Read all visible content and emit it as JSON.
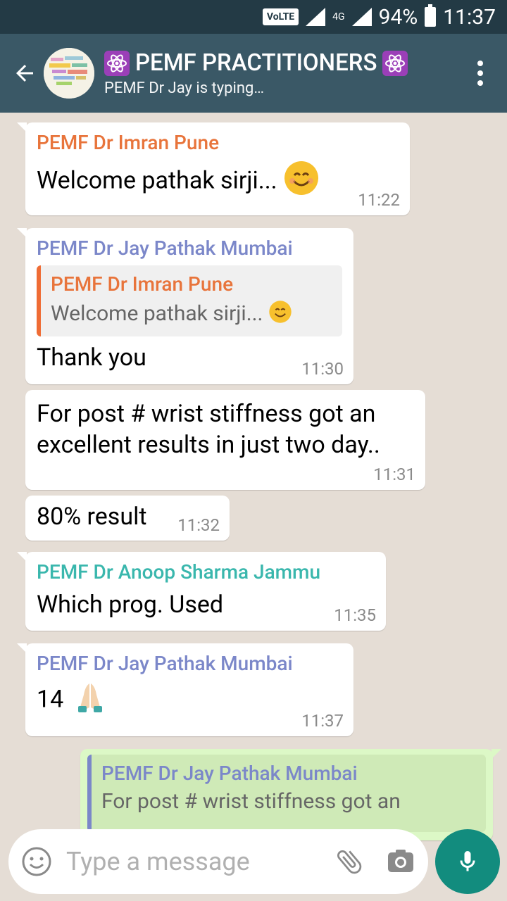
{
  "status": {
    "network": "VoLTE",
    "net_type": "4G",
    "battery": "94%",
    "time": "11:37"
  },
  "header": {
    "title": "PEMF PRACTITIONERS",
    "subtitle": "PEMF Dr Jay is typing…",
    "title_icon": "atom-emoji"
  },
  "colors": {
    "orange": "#e8743b",
    "purple": "#7b87c9",
    "teal": "#3ab7ad",
    "header": "#3a5866"
  },
  "messages": [
    {
      "sender": "PEMF Dr Imran Pune",
      "text": "Welcome pathak sirji...",
      "emoji": "smiling-face",
      "time": "11:22"
    },
    {
      "sender": "PEMF Dr Jay Pathak Mumbai",
      "quote_sender": "PEMF Dr Imran Pune",
      "quote_text": "Welcome pathak sirji...",
      "text": "Thank you",
      "time": "11:30"
    },
    {
      "text": "For post # wrist stiffness got an excellent results in just two day..",
      "time": "11:31"
    },
    {
      "text": "80% result",
      "time": "11:32"
    },
    {
      "sender": "PEMF Dr Anoop Sharma Jammu",
      "text": "Which prog. Used",
      "time": "11:35"
    },
    {
      "sender": "PEMF Dr Jay Pathak Mumbai",
      "text": "14",
      "emoji": "folded-hands",
      "time": "11:37"
    },
    {
      "quote_sender": "PEMF Dr Jay Pathak Mumbai",
      "quote_text": "For post # wrist stiffness got an"
    }
  ],
  "input": {
    "placeholder": "Type a message"
  }
}
